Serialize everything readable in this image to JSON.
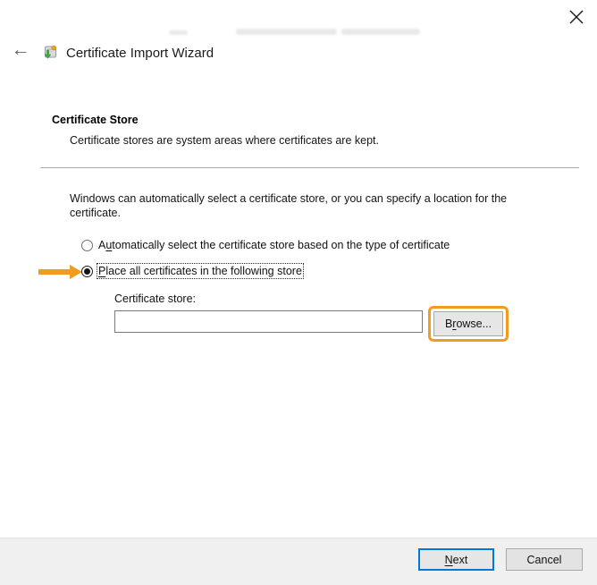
{
  "window": {
    "title": "Certificate Import Wizard"
  },
  "colors": {
    "annotation_orange": "#F29C1F",
    "accent_blue": "#0078D7",
    "footer_bg": "#F0F0F0"
  },
  "header": {
    "back_icon": "left-arrow",
    "back_glyph": "←",
    "close_icon": "close-x",
    "app_icon": "certificate-import-icon"
  },
  "page": {
    "heading": "Certificate Store",
    "subheading": "Certificate stores are system areas where certificates are kept.",
    "description": "Windows can automatically select a certificate store, or you can specify a location for the certificate.",
    "radios": [
      {
        "pre": "A",
        "accel": "u",
        "post": "tomatically select the certificate store based on the type of certificate",
        "selected": false
      },
      {
        "pre": "",
        "accel": "P",
        "post": "lace all certificates in the following store",
        "selected": true
      }
    ],
    "store_label": "Certificate store:",
    "store_input": {
      "value": "",
      "placeholder": ""
    },
    "browse_button": {
      "pre": "B",
      "accel": "r",
      "post": "owse..."
    },
    "annotations": {
      "arrow": "orange-arrow-pointing-to-selected-radio",
      "browse_highlight": "orange-box-around-browse-button"
    }
  },
  "footer": {
    "next_button": {
      "pre": "",
      "accel": "N",
      "post": "ext"
    },
    "cancel_button": {
      "label": "Cancel"
    }
  }
}
